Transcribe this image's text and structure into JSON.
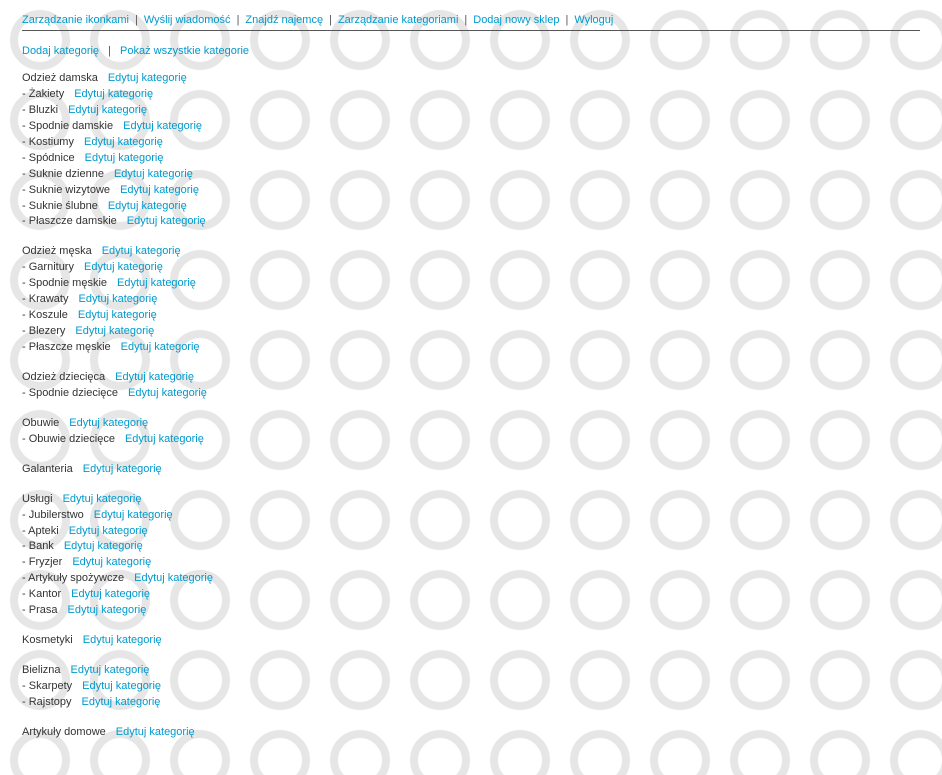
{
  "nav": {
    "items": [
      "Zarządzanie ikonkami",
      "Wyślij wiadomość",
      "Znajdź najemcę",
      "Zarządzanie kategoriami",
      "Dodaj nowy sklep",
      "Wyloguj"
    ],
    "sep": "|"
  },
  "subnav": {
    "add": "Dodaj kategorię",
    "show_all": "Pokaż wszystkie kategorie",
    "sep": "|"
  },
  "edit_label": "Edytuj kategorię",
  "dash": "-",
  "groups": [
    {
      "title": "Odzież damska",
      "children": [
        "Żakiety",
        "Bluzki",
        "Spodnie damskie",
        "Kostiumy",
        "Spódnice",
        "Suknie dzienne",
        "Suknie wizytowe",
        "Suknie ślubne",
        "Płaszcze damskie"
      ]
    },
    {
      "title": "Odzież męska",
      "children": [
        "Garnitury",
        "Spodnie męskie",
        "Krawaty",
        "Koszule",
        "Blezery",
        "Płaszcze męskie"
      ]
    },
    {
      "title": "Odzież dziecięca",
      "children": [
        "Spodnie dziecięce"
      ]
    },
    {
      "title": "Obuwie",
      "children": [
        "Obuwie dziecięce"
      ]
    },
    {
      "title": "Galanteria",
      "children": []
    },
    {
      "title": "Usługi",
      "children": [
        "Jubilerstwo",
        "Apteki",
        "Bank",
        "Fryzjer",
        "Artykuły spożywcze",
        "Kantor",
        "Prasa"
      ]
    },
    {
      "title": "Kosmetyki",
      "children": []
    },
    {
      "title": "Bielizna",
      "children": [
        "Skarpety",
        "Rajstopy"
      ]
    },
    {
      "title": "Artykuły domowe",
      "children": []
    }
  ]
}
